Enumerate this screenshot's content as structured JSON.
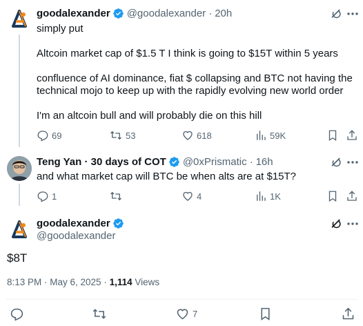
{
  "post1": {
    "name": "goodalexander",
    "handle": "@goodalexander",
    "time": "20h",
    "lines": [
      "simply put",
      "Altcoin market cap of $1.5 T I think is going to $15T within 5 years",
      "confluence of AI dominance, fiat $ collapsing and BTC not having the",
      "technical mojo to keep up with the rapidly evolving new world order",
      "I'm an altcoin bull and will probably die on this hill"
    ],
    "stats": {
      "replies": "69",
      "reposts": "53",
      "likes": "618",
      "views": "59K"
    }
  },
  "post2": {
    "name": "Teng Yan · 30 days of COT",
    "handle": "@0xPrismatic",
    "time": "16h",
    "text": "and what market cap will BTC be when alts are at $15T?",
    "stats": {
      "replies": "1",
      "reposts": "",
      "likes": "4",
      "views": "1K"
    }
  },
  "post3": {
    "name": "goodalexander",
    "handle": "@goodalexander",
    "text": "$8T",
    "time_text": "8:13 PM · May 6, 2025 · ",
    "views_count": "1,114",
    "views_label": " Views",
    "stats": {
      "likes": "7"
    }
  },
  "colors": {
    "accent": "#1d9bf0",
    "muted": "#536471",
    "text": "#0f1419"
  }
}
